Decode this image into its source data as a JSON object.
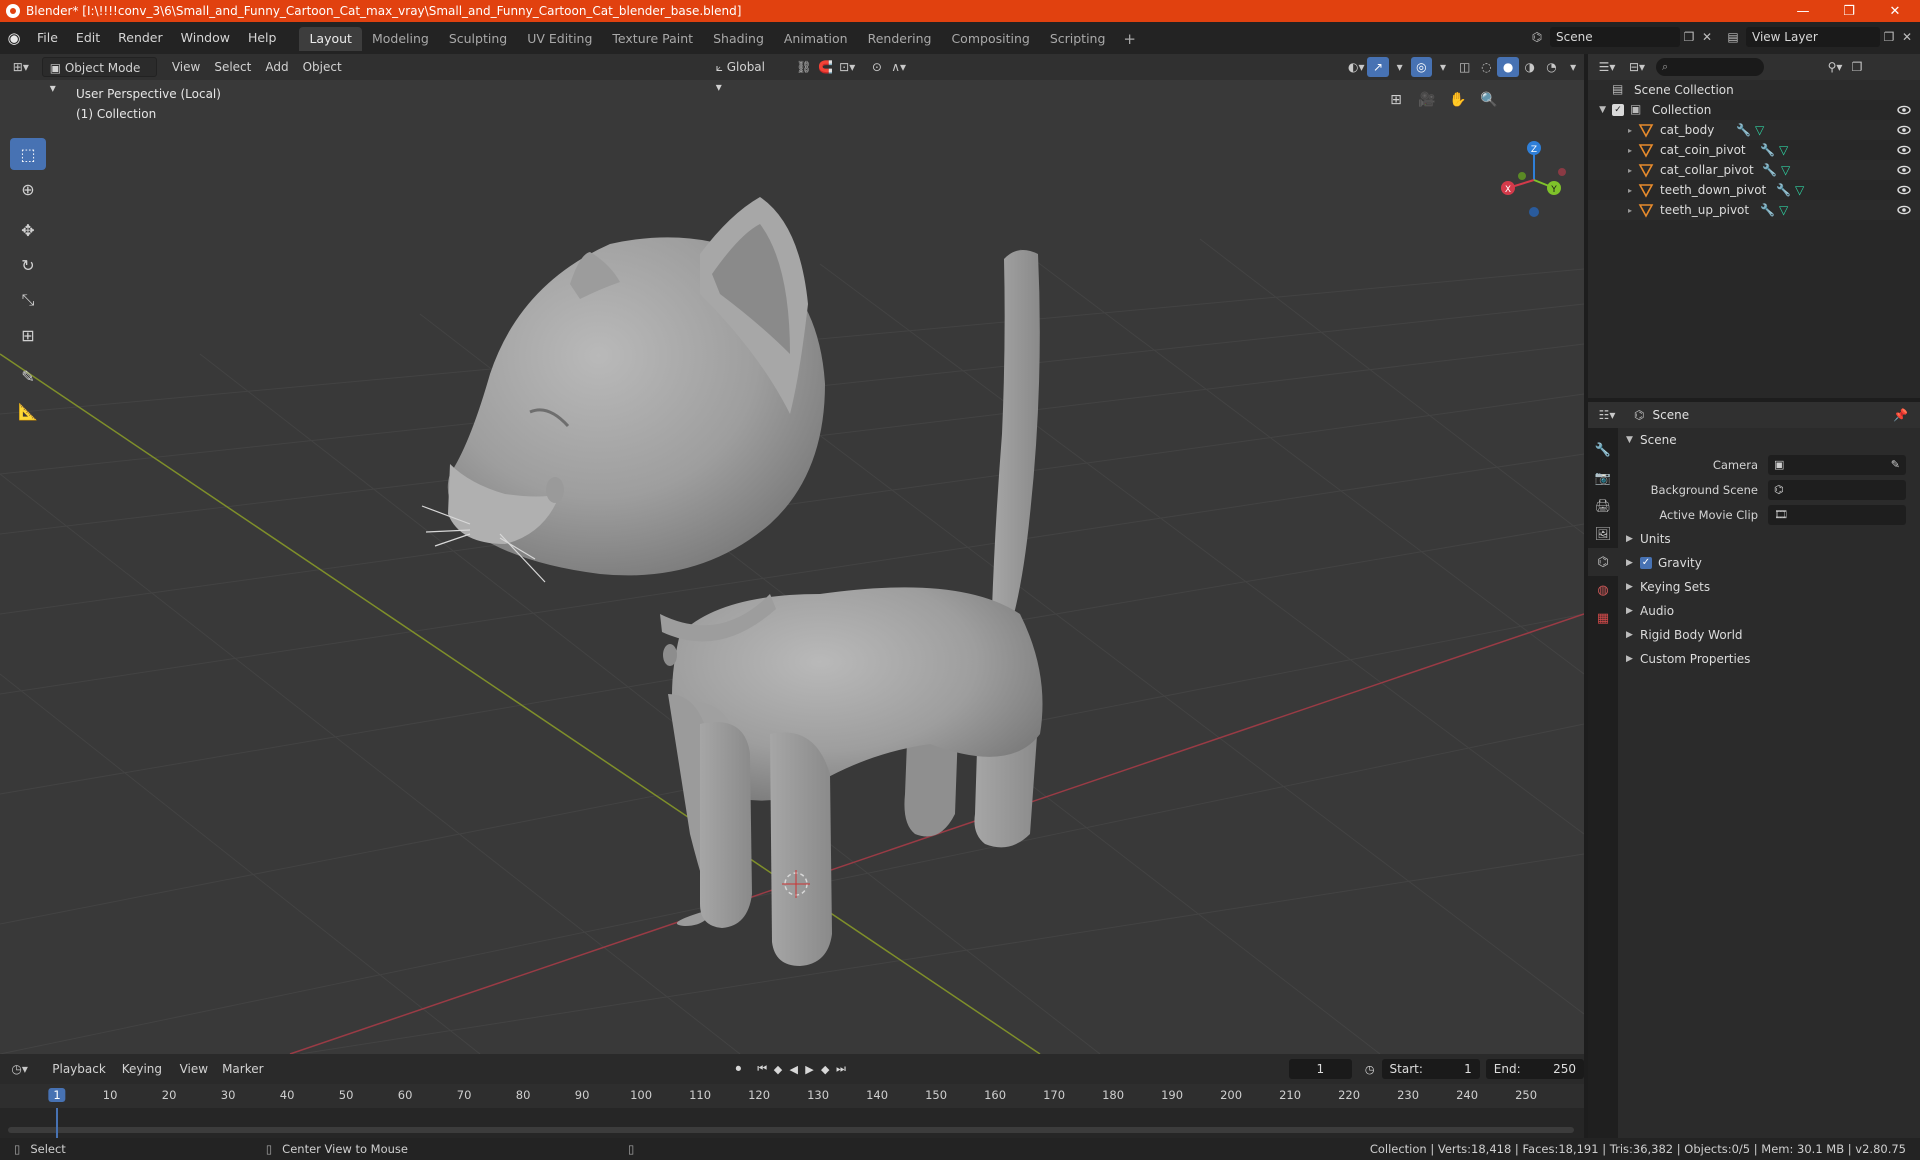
{
  "window": {
    "title": "Blender* [I:\\!!!!conv_3\\6\\Small_and_Funny_Cartoon_Cat_max_vray\\Small_and_Funny_Cartoon_Cat_blender_base.blend]",
    "minimize": "—",
    "restore": "❐",
    "close": "✕"
  },
  "menubar": {
    "items": [
      "File",
      "Edit",
      "Render",
      "Window",
      "Help"
    ],
    "workspaces": [
      "Layout",
      "Modeling",
      "Sculpting",
      "UV Editing",
      "Texture Paint",
      "Shading",
      "Animation",
      "Rendering",
      "Compositing",
      "Scripting"
    ],
    "active_workspace": "Layout",
    "add_tab": "+",
    "scene": "Scene",
    "view_layer": "View Layer"
  },
  "viewport": {
    "mode": "Object Mode",
    "menus": [
      "View",
      "Select",
      "Add",
      "Object"
    ],
    "transform_orientation": "Global",
    "info_line1": "User Perspective (Local)",
    "info_line2": "(1) Collection",
    "gizmo": {
      "x": "X",
      "y": "Y",
      "z": "Z"
    }
  },
  "outliner": {
    "root": "Scene Collection",
    "collection": "Collection",
    "objects": [
      "cat_body",
      "cat_coin_pivot",
      "cat_collar_pivot",
      "teeth_down_pivot",
      "teeth_up_pivot"
    ]
  },
  "properties": {
    "context": "Scene",
    "panel_title": "Scene",
    "fields": [
      {
        "label": "Camera",
        "value": ""
      },
      {
        "label": "Background Scene",
        "value": ""
      },
      {
        "label": "Active Movie Clip",
        "value": ""
      }
    ],
    "subpanels": [
      "Units",
      "Gravity",
      "Keying Sets",
      "Audio",
      "Rigid Body World",
      "Custom Properties"
    ],
    "gravity_checked": "✓"
  },
  "timeline": {
    "menus": [
      "Playback",
      "Keying",
      "View",
      "Marker"
    ],
    "current_frame": "1",
    "start_label": "Start:",
    "start": "1",
    "end_label": "End:",
    "end": "250",
    "ruler_marks": [
      "1",
      "10",
      "20",
      "30",
      "40",
      "50",
      "60",
      "70",
      "80",
      "90",
      "100",
      "110",
      "120",
      "130",
      "140",
      "150",
      "160",
      "170",
      "180",
      "190",
      "200",
      "210",
      "220",
      "230",
      "240",
      "250"
    ]
  },
  "statusbar": {
    "left": "Select",
    "middle": "Center View to Mouse",
    "stats": "Collection | Verts:18,418 | Faces:18,191 | Tris:36,382 | Objects:0/5 | Mem: 30.1 MB | v2.80.75"
  },
  "colors": {
    "accent": "#4772b3",
    "title_bar": "#e1410f",
    "x_axis": "#d33a4a",
    "y_axis": "#7fc22a",
    "z_axis": "#2f7fd8"
  }
}
